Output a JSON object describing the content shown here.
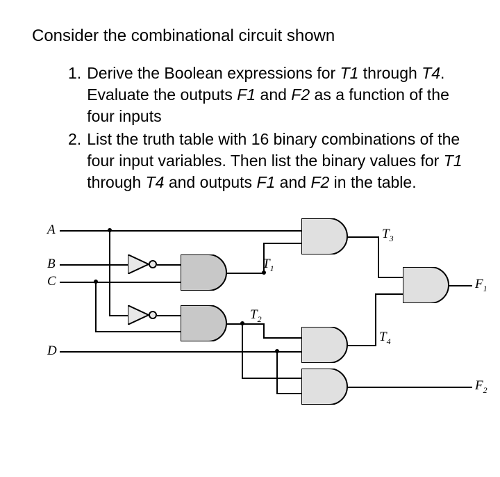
{
  "title": "Consider the combinational circuit shown",
  "items": [
    {
      "num": "1.",
      "text_parts": [
        "Derive the Boolean expressions for ",
        "T1",
        " through ",
        "T4",
        ". Evaluate the outputs ",
        "F1",
        " and ",
        "F2",
        " as a function of the four inputs"
      ]
    },
    {
      "num": "2.",
      "text_parts": [
        "List the truth table with 16 binary combinations of the four input variables. Then list the binary values for ",
        "T1",
        " through ",
        "T4",
        " and outputs ",
        "F1",
        " and ",
        "F2",
        " in the table."
      ]
    }
  ],
  "inputs": {
    "A": "A",
    "B": "B",
    "C": "C",
    "D": "D"
  },
  "signals": {
    "T1": "T",
    "T1s": "1",
    "T2": "T",
    "T2s": "2",
    "T3": "T",
    "T3s": "3",
    "T4": "T",
    "T4s": "4"
  },
  "outputs": {
    "F1": "F",
    "F1s": "1",
    "F2": "F",
    "F2s": "2"
  }
}
